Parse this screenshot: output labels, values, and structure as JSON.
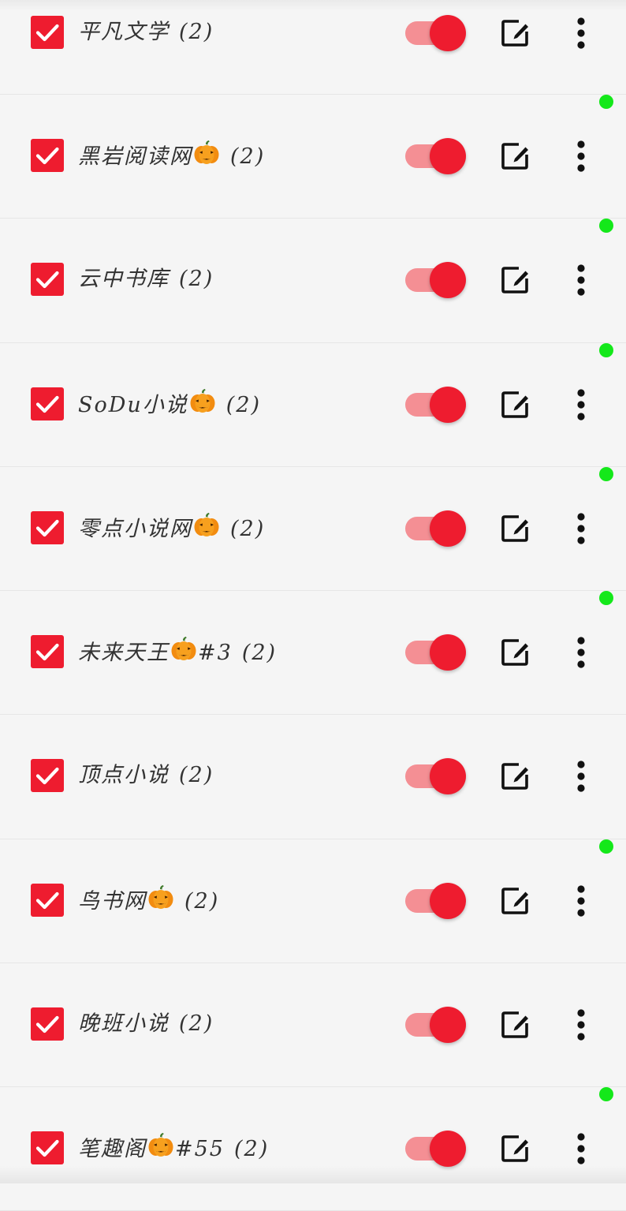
{
  "colors": {
    "accent": "#ee1c2f",
    "track": "#f48f94",
    "status_dot": "#14e81a",
    "background": "#f5f5f5",
    "text": "#333333"
  },
  "icons": {
    "checkbox": "checkbox-checked-icon",
    "toggle": "toggle-on",
    "edit": "edit-icon",
    "more": "more-vertical-icon",
    "status": "online-dot",
    "pumpkin": "jack-o-lantern-emoji"
  },
  "sources": [
    {
      "name": "平凡文学",
      "pumpkin": false,
      "suffix": "",
      "count": "(2)",
      "checked": true,
      "enabled": true,
      "status_dot": true
    },
    {
      "name": "黑岩阅读网",
      "pumpkin": true,
      "suffix": "",
      "count": "(2)",
      "checked": true,
      "enabled": true,
      "status_dot": true
    },
    {
      "name": "云中书库",
      "pumpkin": false,
      "suffix": "",
      "count": "(2)",
      "checked": true,
      "enabled": true,
      "status_dot": true
    },
    {
      "name": "SoDu小说",
      "pumpkin": true,
      "suffix": "",
      "count": "(2)",
      "checked": true,
      "enabled": true,
      "status_dot": true
    },
    {
      "name": "零点小说网",
      "pumpkin": true,
      "suffix": "",
      "count": "(2)",
      "checked": true,
      "enabled": true,
      "status_dot": true
    },
    {
      "name": "未来天王",
      "pumpkin": true,
      "suffix": "#3",
      "count": "(2)",
      "checked": true,
      "enabled": true,
      "status_dot": true
    },
    {
      "name": "顶点小说",
      "pumpkin": false,
      "suffix": "",
      "count": "(2)",
      "checked": true,
      "enabled": true,
      "status_dot": false
    },
    {
      "name": "鸟书网",
      "pumpkin": true,
      "suffix": "",
      "count": "(2)",
      "checked": true,
      "enabled": true,
      "status_dot": true
    },
    {
      "name": "晚班小说",
      "pumpkin": false,
      "suffix": "",
      "count": "(2)",
      "checked": true,
      "enabled": true,
      "status_dot": false
    },
    {
      "name": "笔趣阁",
      "pumpkin": true,
      "suffix": "#55",
      "count": "(2)",
      "checked": true,
      "enabled": true,
      "status_dot": true
    }
  ]
}
